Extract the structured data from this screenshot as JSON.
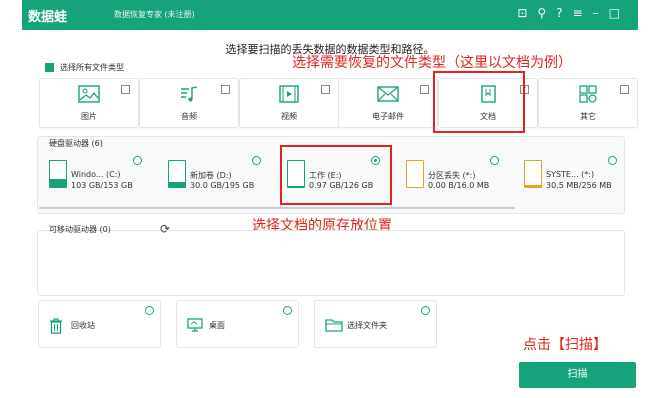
{
  "titlebar": {
    "app_name": "数据蛙",
    "subtitle": "数据恢复专家 (未注册)",
    "icons": [
      "cart-icon",
      "key-icon",
      "help-icon",
      "menu-icon",
      "minimize-icon",
      "close-icon"
    ]
  },
  "instruction": "选择要扫描的丢失数据的数据类型和路径。",
  "select_all_label": "选择所有文件类型",
  "annotations": {
    "file_type": "选择需要恢复的文件类型（这里以文档为例）",
    "location": "选择文档的原存放位置",
    "scan": "点击【扫描】"
  },
  "file_types": [
    {
      "label": "图片",
      "icon": "image-icon",
      "checked": false
    },
    {
      "label": "音频",
      "icon": "music-icon",
      "checked": false
    },
    {
      "label": "视频",
      "icon": "video-icon",
      "checked": false
    },
    {
      "label": "电子邮件",
      "icon": "mail-icon",
      "checked": false
    },
    {
      "label": "文档",
      "icon": "document-icon",
      "checked": true
    },
    {
      "label": "其它",
      "icon": "other-icon",
      "checked": false
    }
  ],
  "hard_drives": {
    "title": "硬盘驱动器 (6)",
    "items": [
      {
        "name": "Windo... (C:)",
        "size": "103 GB/153 GB",
        "selected": false
      },
      {
        "name": "新加卷 (D:)",
        "size": "30.0 GB/195 GB",
        "selected": false
      },
      {
        "name": "工作 (E:)",
        "size": "0.97 GB/126 GB",
        "selected": true
      },
      {
        "name": "分区丢失 (*:)",
        "size": "0.00  B/16.0 MB",
        "selected": false
      },
      {
        "name": "SYSTE... (*:)",
        "size": "30.5 MB/256 MB",
        "selected": false
      }
    ]
  },
  "removable": {
    "title": "可移动驱动器 (0)"
  },
  "locations": [
    {
      "label": "回收站",
      "icon": "trash-icon"
    },
    {
      "label": "桌面",
      "icon": "desktop-icon"
    },
    {
      "label": "选择文件夹",
      "icon": "folder-icon"
    }
  ],
  "scan_button": "扫描",
  "colors": {
    "brand": "#16a37c",
    "annotation": "#e1251b"
  }
}
